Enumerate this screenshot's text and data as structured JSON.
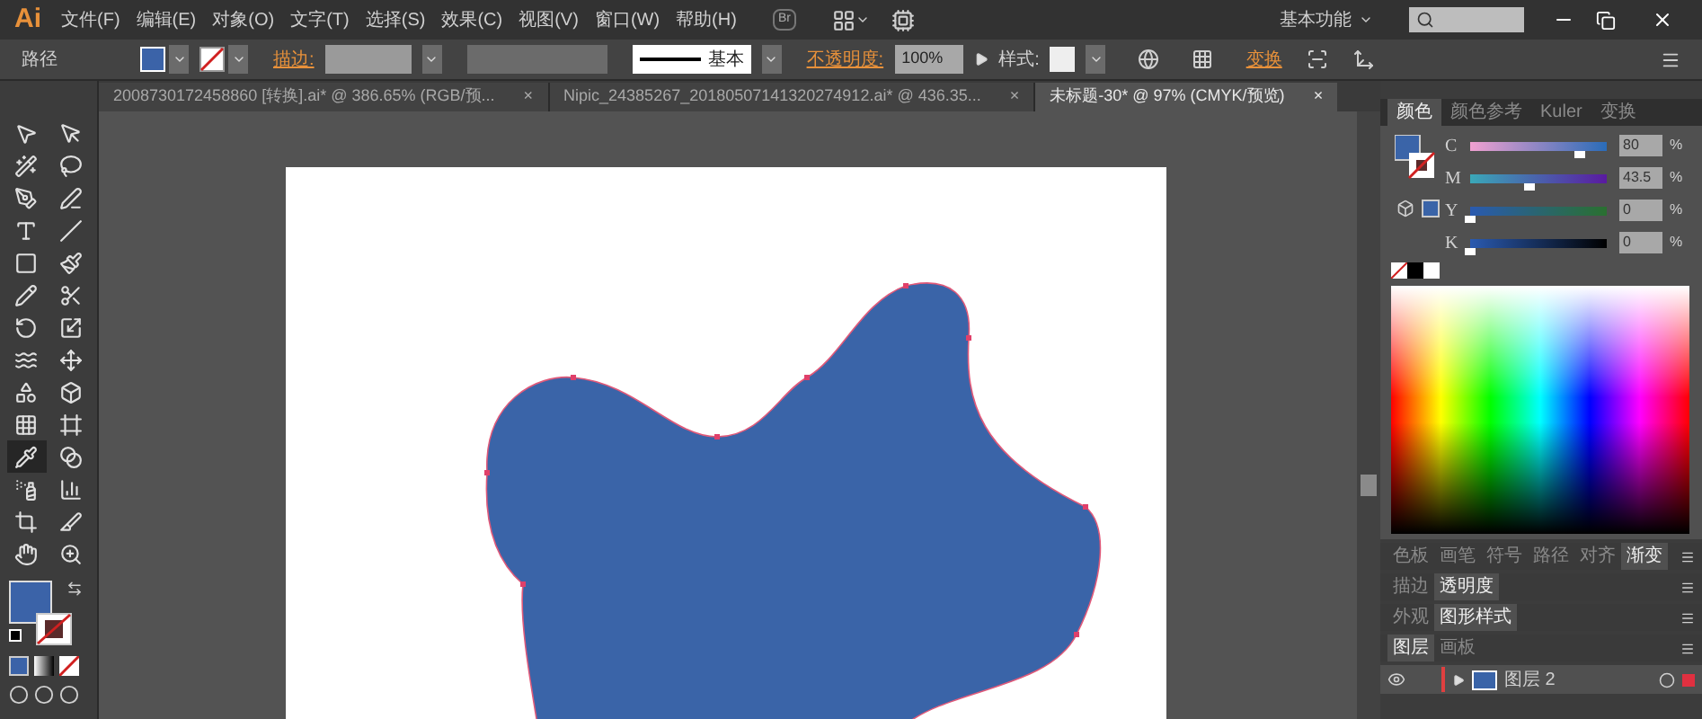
{
  "menu_bar": {
    "logo": "Ai",
    "items": [
      "文件(F)",
      "编辑(E)",
      "对象(O)",
      "文字(T)",
      "选择(S)",
      "效果(C)",
      "视图(V)",
      "窗口(W)",
      "帮助(H)"
    ],
    "bridge": "Br",
    "workspace": "基本功能"
  },
  "control_bar": {
    "object_type": "路径",
    "stroke_label": "描边:",
    "stroke_profile": "基本",
    "opacity_label": "不透明度:",
    "opacity": "100%",
    "style_label": "样式:",
    "transform_link": "变换"
  },
  "document_tabs": [
    {
      "title": "2008730172458860 [转换].ai* @ 386.65% (RGB/预...",
      "close": "×",
      "selected": false
    },
    {
      "title": "Nipic_24385267_20180507141320274912.ai* @ 436.35...",
      "close": "×",
      "selected": false
    },
    {
      "title": "未标题-30* @ 97% (CMYK/预览)",
      "close": "×",
      "selected": true
    }
  ],
  "tools": [
    {
      "selected": false
    },
    {
      "selected": false
    },
    {
      "selected": false
    },
    {
      "selected": false
    },
    {
      "selected": false
    },
    {
      "selected": false
    },
    {
      "selected": false
    },
    {
      "selected": false
    },
    {
      "selected": false
    },
    {
      "selected": false
    },
    {
      "selected": false
    },
    {
      "selected": false
    },
    {
      "selected": false
    },
    {
      "selected": false
    },
    {
      "selected": false
    },
    {
      "selected": false
    },
    {
      "selected": false
    },
    {
      "selected": false
    },
    {
      "selected": false
    },
    {
      "selected": false
    },
    {
      "selected": true
    },
    {
      "selected": false
    },
    {
      "selected": false
    },
    {
      "selected": false
    },
    {
      "selected": false
    },
    {
      "selected": false
    },
    {
      "selected": false
    },
    {
      "selected": false
    }
  ],
  "color_panel": {
    "tabs": [
      {
        "label": "颜色",
        "selected": true
      },
      {
        "label": "颜色参考",
        "selected": false
      },
      {
        "label": "Kuler",
        "selected": false
      },
      {
        "label": "变换",
        "selected": false
      }
    ],
    "channels": [
      {
        "name": "C",
        "level": 0.8,
        "value": "80",
        "unit": "%"
      },
      {
        "name": "M",
        "level": 0.4353,
        "value": "43.5",
        "unit": "%"
      },
      {
        "name": "Y",
        "level": 0,
        "value": "0",
        "unit": "%"
      },
      {
        "name": "K",
        "level": 0,
        "value": "0",
        "unit": "%"
      }
    ]
  },
  "panel_groups": [
    {
      "tabs": [
        {
          "label": "色板",
          "selected": false
        },
        {
          "label": "画笔",
          "selected": false
        },
        {
          "label": "符号",
          "selected": false
        },
        {
          "label": "路径",
          "selected": false
        },
        {
          "label": "对齐",
          "selected": false
        },
        {
          "label": "渐变",
          "selected": true
        }
      ]
    },
    {
      "tabs": [
        {
          "label": "描边",
          "selected": false
        },
        {
          "label": "透明度",
          "selected": true
        }
      ]
    },
    {
      "tabs": [
        {
          "label": "外观",
          "selected": false
        },
        {
          "label": "图形样式",
          "selected": true
        }
      ]
    },
    {
      "tabs": [
        {
          "label": "图层",
          "selected": true
        },
        {
          "label": "画板",
          "selected": false
        }
      ]
    }
  ],
  "layers": [
    {
      "name": "图层 2",
      "visible": true
    }
  ]
}
